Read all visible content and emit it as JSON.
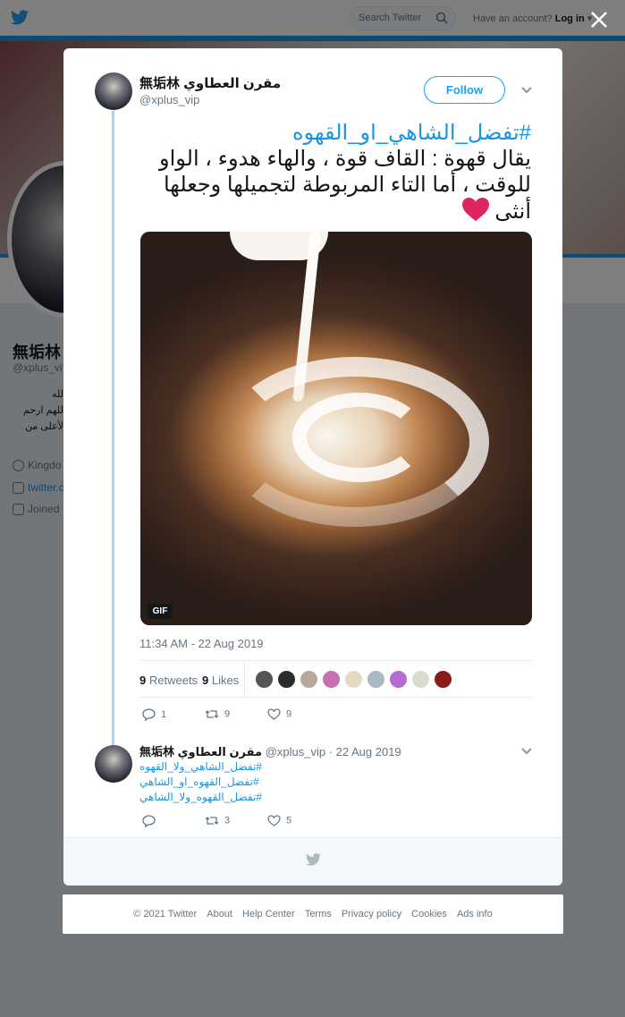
{
  "topbar": {
    "search_placeholder": "Search Twitter",
    "have_account": "Have an account?",
    "login": "Log in"
  },
  "background_profile": {
    "name": "無垢林",
    "handle": "@xplus_vi",
    "bio_lines": [
      "الله",
      "اللهم ارحم",
      "الأعلى من"
    ],
    "location": "Kingdo",
    "link": "twitter.c",
    "joined": "Joined"
  },
  "tweet": {
    "author_name": "無垢林 مقرن العطاوي",
    "author_handle": "@xplus_vip",
    "follow_label": "Follow",
    "hashtag": "#تفضل_الشاهي_او_القهوه",
    "body": "يقال قهوة : القاف قوة ، والهاء هدوء ، الواو للوقت ، أما التاء المربوطة لتجميلها وجعلها أنثى",
    "gif_label": "GIF",
    "timestamp": "11:34 AM - 22 Aug 2019",
    "retweets_count": "9",
    "retweets_label": "Retweets",
    "likes_count": "9",
    "likes_label": "Likes",
    "actions": {
      "replies": "1",
      "retweets": "9",
      "likes": "9"
    }
  },
  "reply": {
    "author_name": "無垢林 مقرن العطاوي",
    "author_handle": "@xplus_vip",
    "date": "· 22 Aug 2019",
    "tags": [
      "#تفضل_الشاهي_ولا_القهوه",
      "#تفضل_القهوه_او_الشاهي",
      "#تفضل_القهوه_ولا_الشاهي"
    ],
    "actions": {
      "replies": "",
      "retweets": "3",
      "likes": "5"
    }
  },
  "footer": {
    "copyright": "© 2021 Twitter",
    "about": "About",
    "help": "Help Center",
    "terms": "Terms",
    "privacy": "Privacy policy",
    "cookies": "Cookies",
    "ads": "Ads info"
  },
  "colors": {
    "brand_blue": "#1da1f2",
    "link_blue": "#1b95e0",
    "thread_line": "#a6d6f5",
    "heart_red": "#e0245e"
  }
}
